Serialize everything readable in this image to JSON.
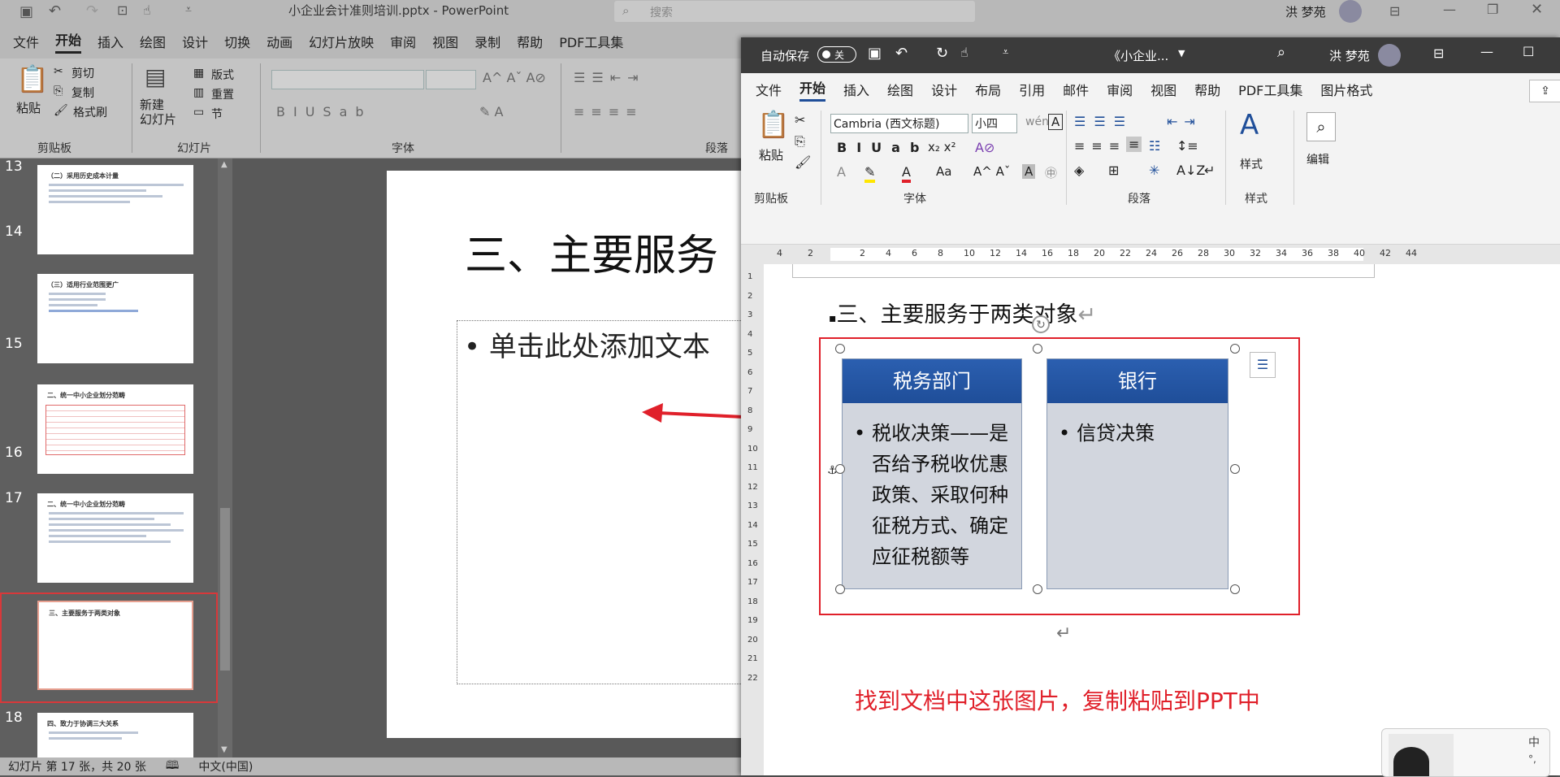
{
  "ppt": {
    "title": "小企业会计准则培训.pptx  -  PowerPoint",
    "search_placeholder": "搜索",
    "user": "洪 梦苑",
    "menu": [
      "文件",
      "开始",
      "插入",
      "绘图",
      "设计",
      "切换",
      "动画",
      "幻灯片放映",
      "审阅",
      "视图",
      "录制",
      "帮助",
      "PDF工具集"
    ],
    "active_menu": "开始",
    "ribbon": {
      "paste": "粘贴",
      "cut": "剪切",
      "copy": "复制",
      "format_painter": "格式刷",
      "clipboard_group": "剪贴板",
      "new_slide": "新建\n幻灯片",
      "layout": "版式",
      "reset": "重置",
      "section": "节",
      "slides_group": "幻灯片",
      "font_group": "字体",
      "paragraph_group": "段落"
    },
    "thumbnails": [
      {
        "num": "13",
        "title": "（二）采用历史成本计量"
      },
      {
        "num": "14",
        "title": "（三）适用行业范围更广"
      },
      {
        "num": "15",
        "title": "二、统一中小企业划分范畴"
      },
      {
        "num": "16",
        "title": "二、统一中小企业划分范畴"
      },
      {
        "num": "17",
        "title": "三、主要服务于两类对象"
      },
      {
        "num": "18",
        "title": "四、致力于协调三大关系"
      }
    ],
    "slide": {
      "title": "三、主要服务",
      "placeholder": "• 单击此处添加文本"
    },
    "status": {
      "slide_info": "幻灯片 第 17 张，共 20 张",
      "language": "中文(中国)"
    }
  },
  "word": {
    "autosave": "自动保存",
    "autosave_state": "关",
    "doc_title": "《小企业...",
    "user": "洪 梦苑",
    "menu": [
      "文件",
      "开始",
      "插入",
      "绘图",
      "设计",
      "布局",
      "引用",
      "邮件",
      "审阅",
      "视图",
      "帮助",
      "PDF工具集",
      "图片格式"
    ],
    "active_menu": "开始",
    "ribbon": {
      "paste": "粘贴",
      "font_name": "Cambria (西文标题)",
      "font_size": "小四",
      "styles": "样式",
      "edit": "编辑",
      "clipboard_group": "剪贴板",
      "font_group": "字体",
      "paragraph_group": "段落",
      "styles_group": "样式"
    },
    "ruler_marks": [
      "4",
      "2",
      "",
      "2",
      "4",
      "6",
      "8",
      "10",
      "12",
      "14",
      "16",
      "18",
      "20",
      "22",
      "24",
      "26",
      "28",
      "30",
      "32",
      "34",
      "36",
      "38",
      "40",
      "42",
      "44"
    ],
    "vruler_marks": [
      "1",
      "2",
      "3",
      "4",
      "5",
      "6",
      "7",
      "8",
      "9",
      "10",
      "11",
      "12",
      "13",
      "14",
      "15",
      "16",
      "17",
      "18",
      "19",
      "20",
      "21",
      "22"
    ],
    "doc": {
      "heading": "三、主要服务于两类对象",
      "col1_header": "税务部门",
      "col1_body": "税收决策——是否给予税收优惠政策、采取何种征税方式、确定应征税额等",
      "col2_header": "银行",
      "col2_body": "信贷决策",
      "annotation": "找到文档中这张图片，复制粘贴到PPT中"
    }
  },
  "ime": {
    "mode": "中"
  },
  "colors": {
    "accent_red": "#e0202a",
    "header_blue": "#1f4e99",
    "cell_gray": "#d2d6de"
  }
}
